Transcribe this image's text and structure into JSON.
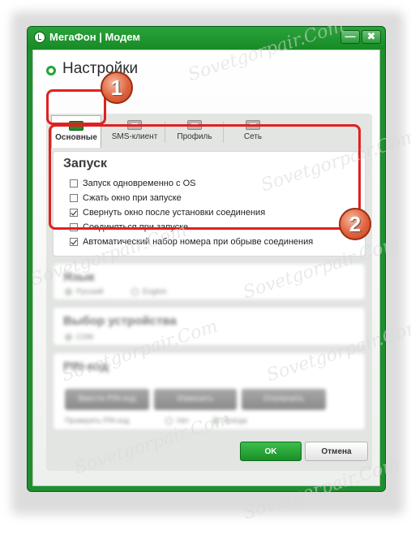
{
  "window": {
    "title": "МегаФон | Модем",
    "minimize_label": "—",
    "close_label": "✖"
  },
  "page": {
    "heading": "Настройки"
  },
  "tabs": [
    {
      "label": "Основные",
      "active": true
    },
    {
      "label": "SMS-клиент",
      "active": false
    },
    {
      "label": "Профиль",
      "active": false
    },
    {
      "label": "Сеть",
      "active": false
    }
  ],
  "startup": {
    "title": "Запуск",
    "options": [
      {
        "label": "Запуск одновременно с OS",
        "checked": false
      },
      {
        "label": "Сжать окно при запуске",
        "checked": false
      },
      {
        "label": "Свернуть окно после установки соединения",
        "checked": true
      },
      {
        "label": "Соединяться при запуске",
        "checked": false
      },
      {
        "label": "Автоматический набор номера при обрыве соединения",
        "checked": true
      }
    ]
  },
  "language": {
    "title": "Язык",
    "options": [
      "Русский",
      "English"
    ],
    "selected": "Русский"
  },
  "device": {
    "title": "Выбор устройства",
    "option": "COM"
  },
  "pin": {
    "title": "PIN-код",
    "buttons": [
      "Ввести PIN-код",
      "Изменить",
      "Отключить"
    ],
    "check_label": "Проверять PIN-код",
    "check_options": [
      "Нет",
      "Всегда"
    ]
  },
  "footer": {
    "ok_label": "OK",
    "cancel_label": "Отмена"
  },
  "annotations": {
    "badge_1": "1",
    "badge_2": "2"
  },
  "watermark": "Sovetgorpair.Com",
  "colors": {
    "titlebar": "#1e8f2e",
    "accent_green": "#25a43a",
    "highlight_red": "#e02020",
    "badge_orange": "#e0633f"
  }
}
